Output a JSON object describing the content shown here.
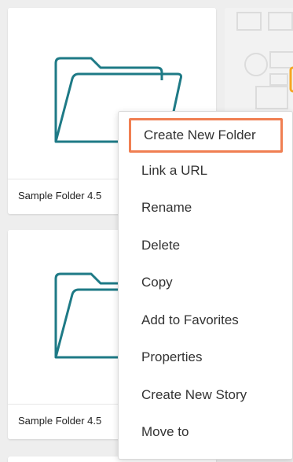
{
  "colors": {
    "folder_stroke": "#1e7a86",
    "highlight_border": "#f07f52",
    "side_card_accent": "#f5a623"
  },
  "cards": [
    {
      "name": "Sample Folder 4.5",
      "icon": "folder-icon"
    },
    {
      "name": "Sample Folder 4.5",
      "icon": "folder-icon"
    }
  ],
  "context_menu": {
    "items": [
      {
        "label": "Create New Folder",
        "highlighted": true
      },
      {
        "label": "Link a URL"
      },
      {
        "label": "Rename"
      },
      {
        "label": "Delete"
      },
      {
        "label": "Copy"
      },
      {
        "label": "Add to Favorites"
      },
      {
        "label": "Properties"
      },
      {
        "label": "Create New Story"
      },
      {
        "label": "Move to"
      }
    ]
  }
}
